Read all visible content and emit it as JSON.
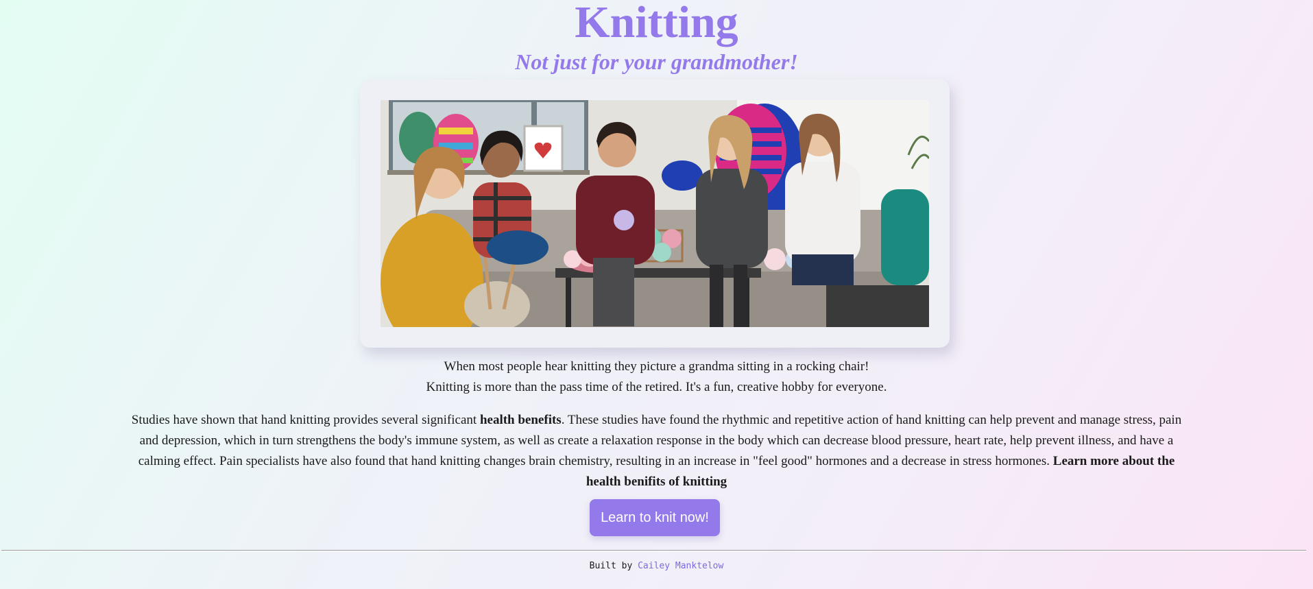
{
  "header": {
    "title": "Knitting",
    "subtitle": "Not just for your grandmother!"
  },
  "intro": {
    "line1": "When most people hear knitting they picture a grandma sitting in a rocking chair!",
    "line2": "Knitting is more than the pass time of the retired. It's a fun, creative hobby for everyone."
  },
  "benefits": {
    "part1": "Studies have shown that hand knitting provides several significant ",
    "bold1": "health benefits",
    "part2": ". These studies have found the rhythmic and repetitive action of hand knitting can help prevent and manage stress, pain and depression, which in turn strengthens the body's immune system, as well as create a relaxation response in the body which can decrease blood pressure, heart rate, help prevent illness, and have a calming effect. Pain specialists have also found that hand knitting changes brain chemistry, resulting in an increase in \"feel good\" hormones and a decrease in stress hormones. ",
    "link": "Learn more about the health benifits of knitting"
  },
  "cta": {
    "label": "Learn to knit now!"
  },
  "footer": {
    "prefix": "Built by ",
    "author": "Cailey Manktelow"
  },
  "colors": {
    "accent": "#9379ea",
    "link": "#7a6be0"
  }
}
